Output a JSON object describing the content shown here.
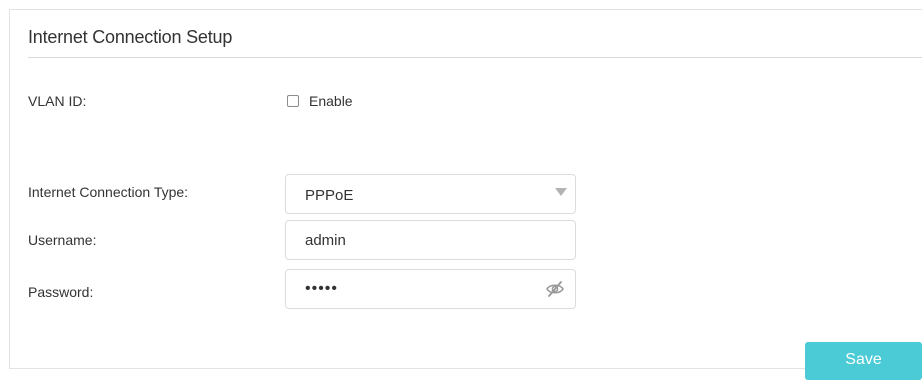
{
  "section": {
    "title": "Internet Connection Setup"
  },
  "vlan": {
    "label": "VLAN ID:",
    "checkbox_label": "Enable",
    "checked": false
  },
  "connection_type": {
    "label": "Internet Connection Type:",
    "value": "PPPoE"
  },
  "username": {
    "label": "Username:",
    "value": "admin"
  },
  "password": {
    "label": "Password:",
    "masked_value": "•••••"
  },
  "actions": {
    "save_label": "Save"
  },
  "icons": {
    "select_arrow": "chevron-down-icon",
    "password_toggle": "eye-off-icon"
  },
  "colors": {
    "accent": "#4acbd6",
    "border": "#dcdcdc",
    "text": "#333333"
  }
}
